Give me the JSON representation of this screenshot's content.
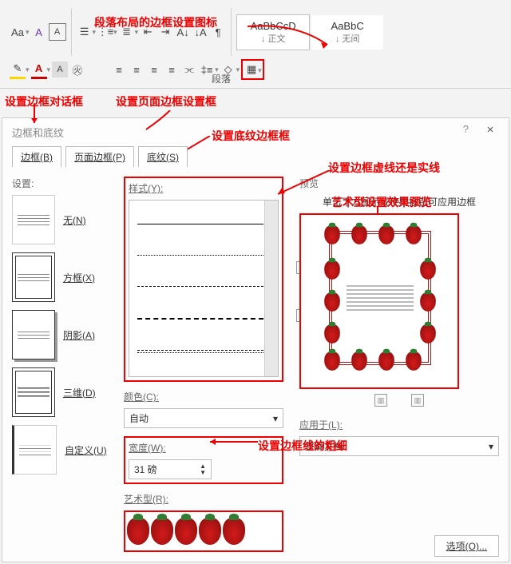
{
  "ribbon": {
    "group_paragraph": "段落",
    "annotation_border_icon": "段落布局的边框设置图标",
    "style_body_name": "AaBbCcD",
    "style_body_label": "↓ 正文",
    "style_nospace_name": "AaBbC",
    "style_nospace_label": "↓ 无间"
  },
  "annotations": {
    "dialog_title": "设置边框对话框",
    "page_border": "设置页面边框设置框",
    "shading_tab": "设置底纹边框框",
    "dashed_solid": "设置边框虚线还是实线",
    "width": "设置边框线的粗细",
    "art_preview": "艺术型设置效果预览"
  },
  "dialog": {
    "title": "边框和底纹",
    "help": "?",
    "close": "×",
    "tabs": {
      "border": "边框(B)",
      "page": "页面边框(P)",
      "shading": "底纹(S)"
    },
    "setting_label": "设置:",
    "presets": {
      "none": "无(N)",
      "box": "方框(X)",
      "shadow": "阴影(A)",
      "threed": "三维(D)",
      "custom": "自定义(U)"
    },
    "style_label": "样式(Y):",
    "color_label": "颜色(C):",
    "color_value": "自动",
    "width_label": "宽度(W):",
    "width_value": "31 磅",
    "art_label": "艺术型(R):",
    "preview_label": "预览",
    "preview_hint": "单击下方图示或使用按钮可应用边框",
    "apply_label": "应用于(L):",
    "apply_value": "整篇文档",
    "options_btn": "选项(O)..."
  }
}
